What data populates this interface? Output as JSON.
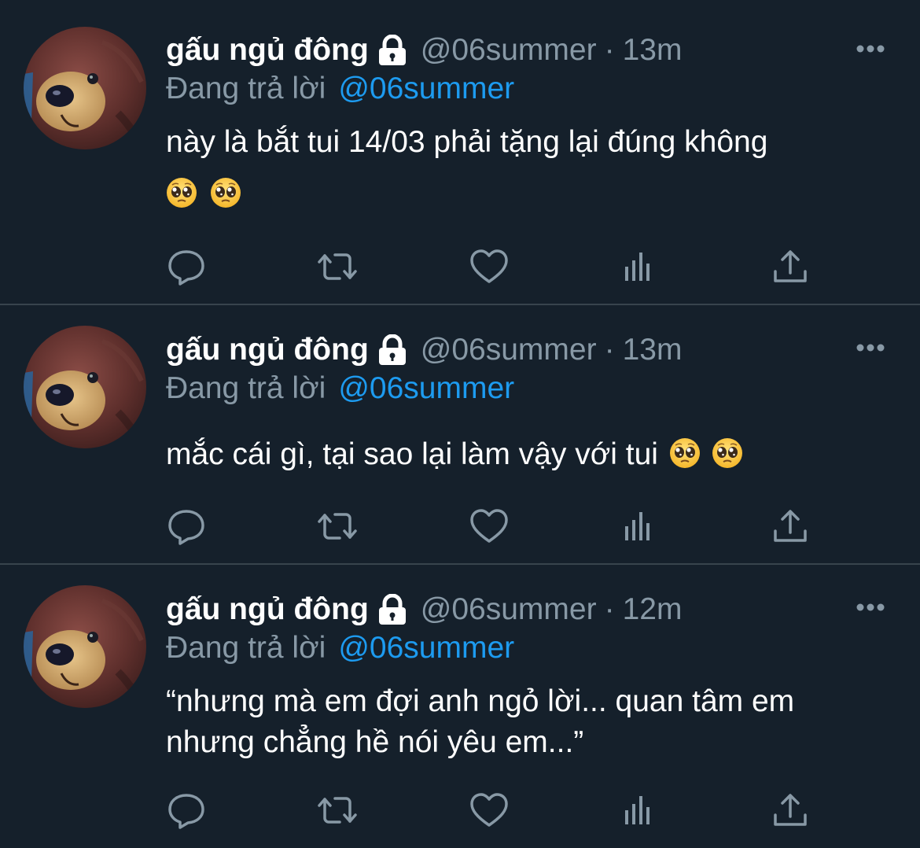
{
  "colors": {
    "background": "#15202b",
    "divider": "#38444d",
    "muted": "#8899a6",
    "link": "#1d9bf0",
    "text": "#ffffff"
  },
  "tweets": [
    {
      "author_name": "gấu ngủ đông",
      "handle": "@06summer",
      "separator": "·",
      "time": "13m",
      "replying_label": "Đang trả lời",
      "replying_to": "@06summer",
      "text_lines": [
        "này là bắt tui 14/03 phải tặng lại đúng không"
      ],
      "emoji_line": "pleading-face pleading-face"
    },
    {
      "author_name": "gấu ngủ đông",
      "handle": "@06summer",
      "separator": "·",
      "time": "13m",
      "replying_label": "Đang trả lời",
      "replying_to": "@06summer",
      "text_lines": [
        "mắc cái gì, tại sao lại làm vậy với tui"
      ]
    },
    {
      "author_name": "gấu ngủ đông",
      "handle": "@06summer",
      "separator": "·",
      "time": "12m",
      "replying_label": "Đang trả lời",
      "replying_to": "@06summer",
      "text_lines": [
        "“nhưng mà em đợi anh ngỏ lời... quan tâm em",
        "nhưng chẳng hề nói yêu em...”"
      ]
    }
  ],
  "icons": {
    "lock": "lock-icon",
    "more": "more-icon",
    "reply": "reply-icon",
    "retweet": "retweet-icon",
    "like": "heart-icon",
    "analytics": "analytics-icon",
    "share": "share-icon",
    "emoji": "pleading-face-emoji"
  }
}
